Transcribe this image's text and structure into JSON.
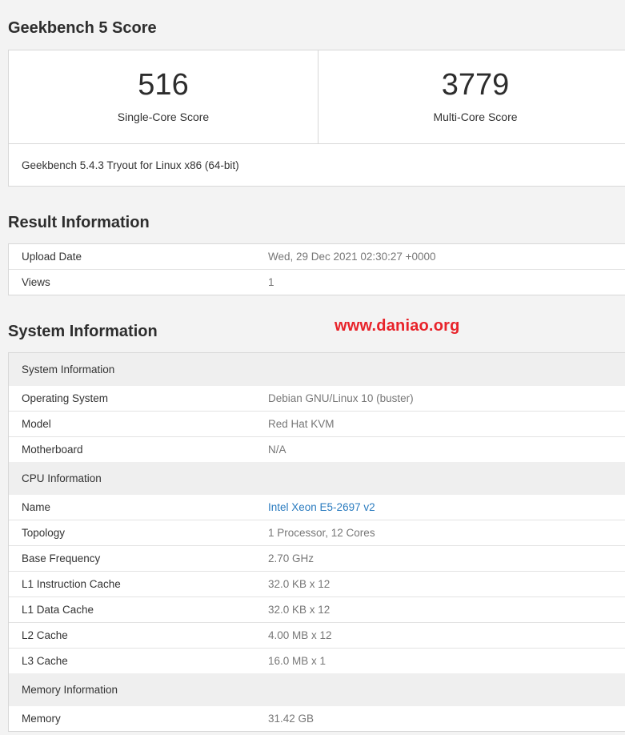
{
  "score_section": {
    "title": "Geekbench 5 Score",
    "single": {
      "value": "516",
      "label": "Single-Core Score"
    },
    "multi": {
      "value": "3779",
      "label": "Multi-Core Score"
    },
    "version": "Geekbench 5.4.3 Tryout for Linux x86 (64-bit)"
  },
  "result_section": {
    "title": "Result Information",
    "rows": [
      {
        "key": "Upload Date",
        "value": "Wed, 29 Dec 2021 02:30:27 +0000"
      },
      {
        "key": "Views",
        "value": "1"
      }
    ]
  },
  "watermark": "www.daniao.org",
  "system_section": {
    "title": "System Information",
    "groups": [
      {
        "heading": "System Information",
        "rows": [
          {
            "key": "Operating System",
            "value": "Debian GNU/Linux 10 (buster)"
          },
          {
            "key": "Model",
            "value": "Red Hat KVM"
          },
          {
            "key": "Motherboard",
            "value": "N/A"
          }
        ]
      },
      {
        "heading": "CPU Information",
        "rows": [
          {
            "key": "Name",
            "value": "Intel Xeon E5-2697 v2"
          },
          {
            "key": "Topology",
            "value": "1 Processor, 12 Cores"
          },
          {
            "key": "Base Frequency",
            "value": "2.70 GHz"
          },
          {
            "key": "L1 Instruction Cache",
            "value": "32.0 KB x 12"
          },
          {
            "key": "L1 Data Cache",
            "value": "32.0 KB x 12"
          },
          {
            "key": "L2 Cache",
            "value": "4.00 MB x 12"
          },
          {
            "key": "L3 Cache",
            "value": "16.0 MB x 1"
          }
        ]
      },
      {
        "heading": "Memory Information",
        "rows": [
          {
            "key": "Memory",
            "value": "31.42 GB"
          }
        ]
      }
    ]
  }
}
